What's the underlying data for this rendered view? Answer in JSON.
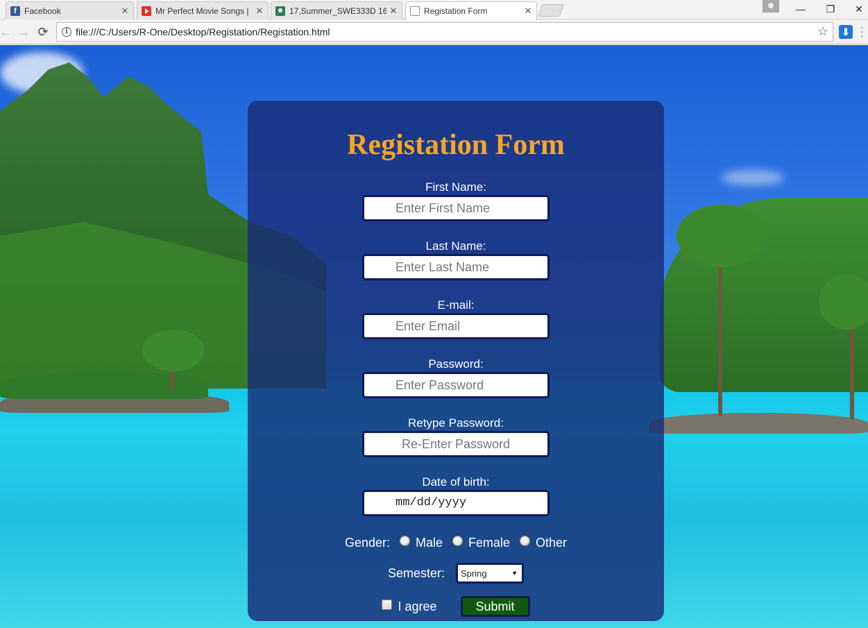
{
  "browser": {
    "tabs": [
      {
        "title": "Facebook",
        "icon": "facebook-icon"
      },
      {
        "title": "Mr Perfect Movie Songs |",
        "icon": "youtube-icon"
      },
      {
        "title": "17,Summer_SWE333D 16",
        "icon": "classroom-icon"
      },
      {
        "title": "Registation Form",
        "icon": "document-icon",
        "active": true
      }
    ],
    "tab_close_glyph": "✕",
    "window_controls": {
      "minimize": "—",
      "restore": "❐",
      "close": "✕"
    },
    "nav": {
      "back": "←",
      "forward": "→",
      "reload": "⟳"
    },
    "address": "file:///C:/Users/R-One/Desktop/Registation/Registation.html",
    "info_glyph": "i",
    "bookmark_glyph": "☆",
    "download_glyph": "⬇"
  },
  "form": {
    "title": "Registation Form",
    "first_name": {
      "label": "First Name:",
      "placeholder": "Enter First Name",
      "value": ""
    },
    "last_name": {
      "label": "Last Name:",
      "placeholder": "Enter Last Name",
      "value": ""
    },
    "email": {
      "label": "E-mail:",
      "placeholder": "Enter Email",
      "value": ""
    },
    "password": {
      "label": "Password:",
      "placeholder": "Enter Password",
      "value": ""
    },
    "retype_password": {
      "label": "Retype Password:",
      "placeholder": "Re-Enter Password",
      "value": ""
    },
    "dob": {
      "label": "Date of birth:",
      "placeholder": "mm/dd/yyyy"
    },
    "gender": {
      "label": "Gender:",
      "options": [
        "Male",
        "Female",
        "Other"
      ],
      "selected": null
    },
    "semester": {
      "label": "Semester:",
      "selected": "Spring"
    },
    "agree": {
      "label": "I agree",
      "checked": false
    },
    "submit_label": "Submit"
  },
  "colors": {
    "title": "#f5a623",
    "panel": "#192d78",
    "submit": "#0f5a0f",
    "input_border": "#0d1a5c"
  }
}
